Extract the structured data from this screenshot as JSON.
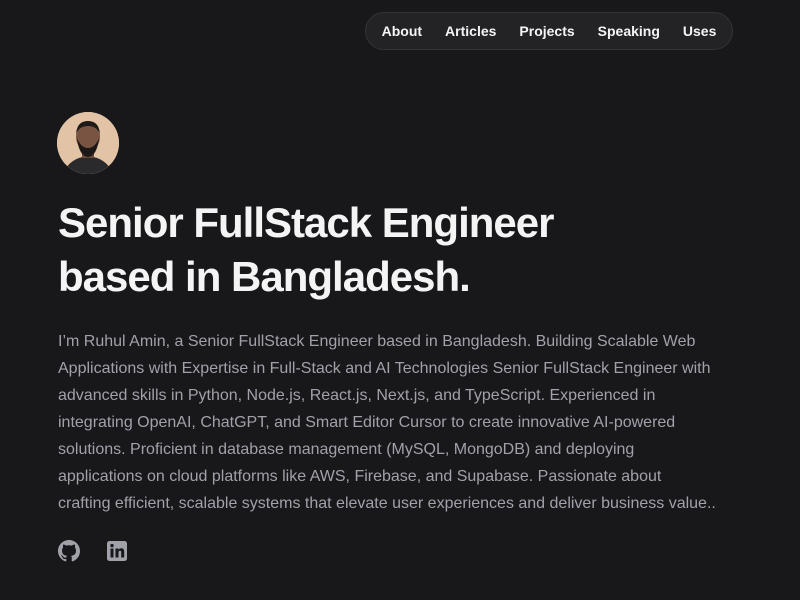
{
  "nav": {
    "items": [
      {
        "label": "About"
      },
      {
        "label": "Articles"
      },
      {
        "label": "Projects"
      },
      {
        "label": "Speaking"
      },
      {
        "label": "Uses"
      }
    ]
  },
  "hero": {
    "headline_line1": "Senior FullStack Engineer",
    "headline_line2": "based in Bangladesh.",
    "bio": "I’m Ruhul Amin, a Senior FullStack Engineer based in Bangladesh. Building Scalable Web Applications with Expertise in Full-Stack and AI Technologies Senior FullStack Engineer with advanced skills in Python, Node.js, React.js, Next.js, and TypeScript. Experienced in integrating OpenAI, ChatGPT, and Smart Editor Cursor to create innovative AI-powered solutions. Proficient in database management (MySQL, MongoDB) and deploying applications on cloud platforms like AWS, Firebase, and Supabase. Passionate about crafting efficient, scalable systems that elevate user experiences and deliver business value.."
  },
  "socials": [
    {
      "icon": "github-icon"
    },
    {
      "icon": "linkedin-icon"
    }
  ],
  "colors": {
    "background": "#18181b",
    "nav_background": "#232326",
    "text_primary": "#f4f4f5",
    "text_secondary": "#a1a1aa",
    "icon": "#a1a1aa"
  }
}
